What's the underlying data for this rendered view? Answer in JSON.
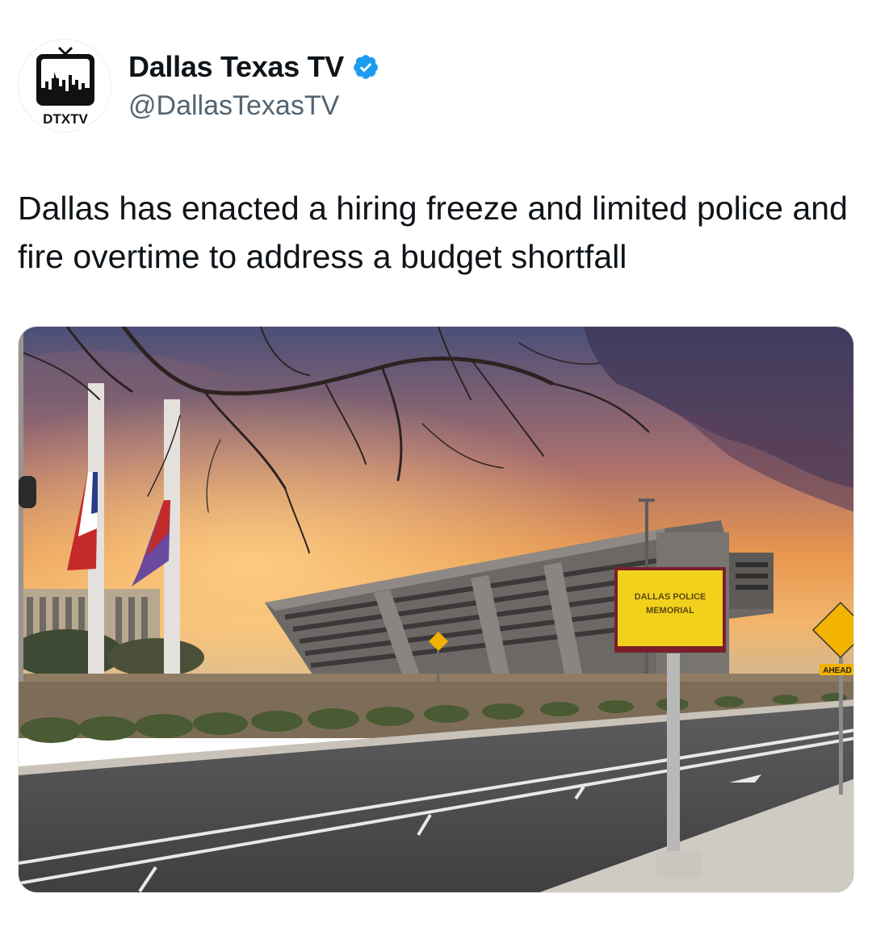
{
  "author": {
    "display_name": "Dallas Texas TV",
    "handle": "@DallasTexasTV",
    "verified": true,
    "avatar_logo_text": "DTXTV",
    "verified_color": "#1d9bf0"
  },
  "tweet": {
    "text": "Dallas has enacted a hiring freeze and limited police and fire overtime to address a budget shortfall"
  },
  "media": {
    "sign_line1": "DALLAS POLICE",
    "sign_line2": "MEMORIAL",
    "road_sign_text": "AHEAD",
    "sign_color": "#f2d11c"
  }
}
